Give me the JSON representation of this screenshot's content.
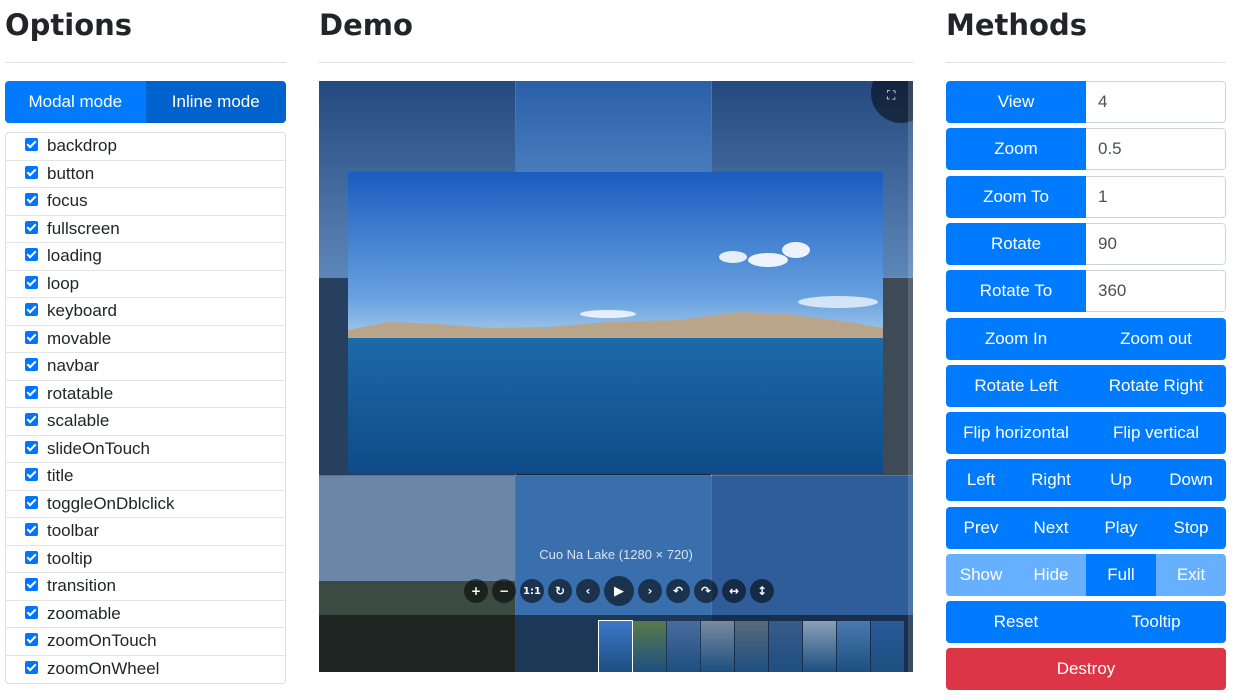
{
  "headings": {
    "options": "Options",
    "demo": "Demo",
    "methods": "Methods"
  },
  "modes": {
    "modal": "Modal mode",
    "inline": "Inline mode"
  },
  "options": [
    "backdrop",
    "button",
    "focus",
    "fullscreen",
    "loading",
    "loop",
    "keyboard",
    "movable",
    "navbar",
    "rotatable",
    "scalable",
    "slideOnTouch",
    "title",
    "toggleOnDblclick",
    "toolbar",
    "tooltip",
    "transition",
    "zoomable",
    "zoomOnTouch",
    "zoomOnWheel"
  ],
  "viewer": {
    "caption": "Cuo Na Lake (1280 × 720)",
    "fullscreen_icon": "fullscreen-icon",
    "toolbar": {
      "zoom_in": "+",
      "zoom_out": "−",
      "one_to_one": "1:1",
      "reset": "↻",
      "prev": "‹",
      "play": "▶",
      "next": "›",
      "rotate_left": "↶",
      "rotate_right": "↷",
      "flip_h": "↔",
      "flip_v": "↕"
    }
  },
  "methods": {
    "view": {
      "label": "View",
      "value": "4"
    },
    "zoom": {
      "label": "Zoom",
      "value": "0.5"
    },
    "zoom_to": {
      "label": "Zoom To",
      "value": "1"
    },
    "rotate": {
      "label": "Rotate",
      "value": "90"
    },
    "rotate_to": {
      "label": "Rotate To",
      "value": "360"
    },
    "zoom_in": "Zoom In",
    "zoom_out": "Zoom out",
    "rotate_left": "Rotate Left",
    "rotate_right": "Rotate Right",
    "flip_h": "Flip horizontal",
    "flip_v": "Flip vertical",
    "left": "Left",
    "right": "Right",
    "up": "Up",
    "down": "Down",
    "prev": "Prev",
    "next": "Next",
    "play": "Play",
    "stop": "Stop",
    "show": "Show",
    "hide": "Hide",
    "full": "Full",
    "exit": "Exit",
    "reset": "Reset",
    "tooltip": "Tooltip",
    "destroy": "Destroy"
  },
  "colors": {
    "primary": "#007bff",
    "primary_dark": "#0062cc",
    "primary_light": "#66b0ff",
    "danger": "#dc3545"
  }
}
